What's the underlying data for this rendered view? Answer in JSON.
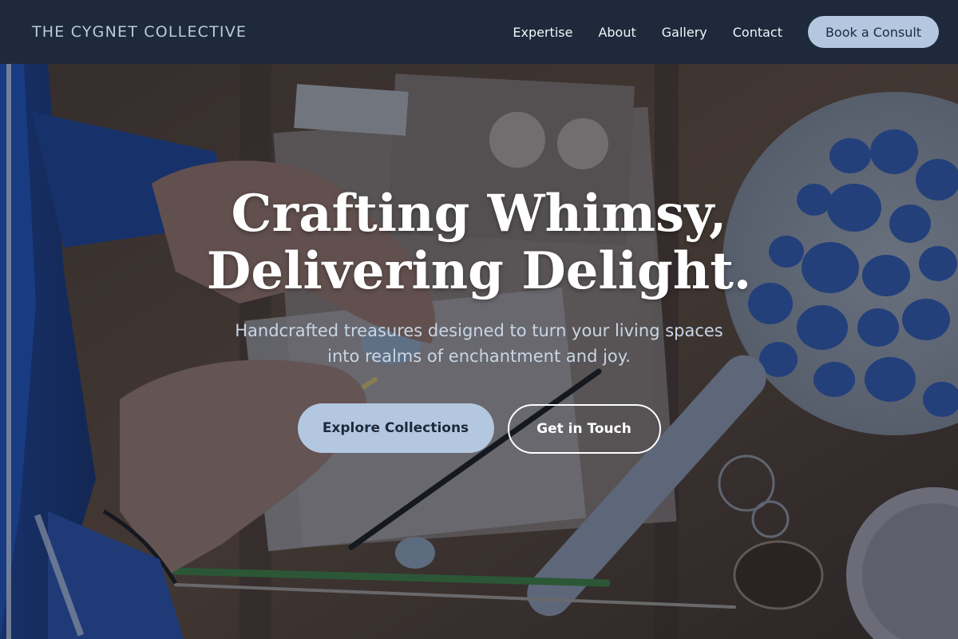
{
  "brand": {
    "name": "THE CYGNET COLLECTIVE"
  },
  "nav": {
    "links": [
      "Expertise",
      "About",
      "Gallery",
      "Contact"
    ],
    "cta_label": "Book a Consult"
  },
  "hero": {
    "title_line1": "Crafting Whimsy,",
    "title_line2": "Delivering Delight.",
    "subtitle_line1": "Handcrafted treasures designed to turn your living spaces",
    "subtitle_line2": "into realms of enchantment and joy.",
    "primary_button": "Explore Collections",
    "secondary_button": "Get in Touch",
    "background_image": "crafting-table-photo"
  },
  "colors": {
    "nav_background": "#1e293b",
    "brand_text": "#b8cbe2",
    "accent": "#b3c8e0",
    "subtitle_text": "#c9d6e6"
  }
}
